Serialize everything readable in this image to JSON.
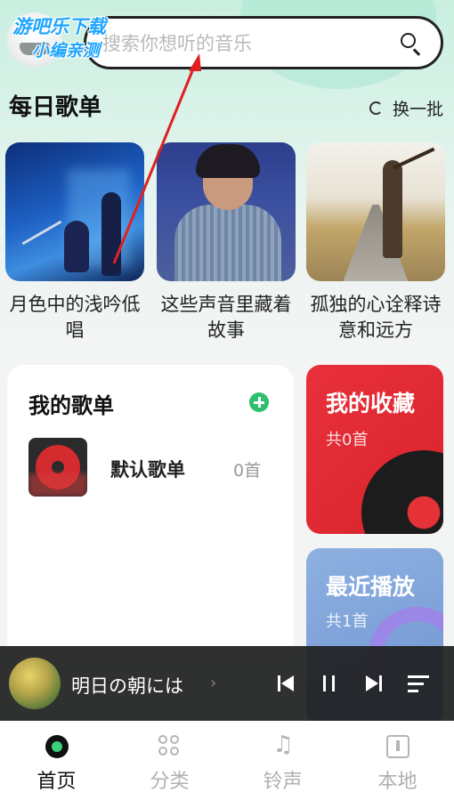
{
  "watermark": {
    "line1": "游吧乐下载",
    "line2": "小编亲测"
  },
  "search": {
    "placeholder": "搜索你想听的音乐"
  },
  "daily": {
    "title": "每日歌单",
    "refresh_label": "换一批",
    "playlists": [
      {
        "caption": "月色中的浅吟低唱"
      },
      {
        "caption": "这些声音里藏着故事"
      },
      {
        "caption": "孤独的心诠释诗意和远方"
      }
    ]
  },
  "my_playlists": {
    "title": "我的歌单",
    "items": [
      {
        "name": "默认歌单",
        "count": "0首"
      }
    ]
  },
  "favorites": {
    "title": "我的收藏",
    "count": "共0首",
    "color": "#e8303a"
  },
  "recent": {
    "title": "最近播放",
    "count": "共1首",
    "color": "#8eb1e2"
  },
  "player": {
    "song_title": "明日の朝には"
  },
  "tabs": [
    {
      "label": "首页",
      "icon": "home-icon",
      "active": true
    },
    {
      "label": "分类",
      "icon": "category-icon",
      "active": false
    },
    {
      "label": "铃声",
      "icon": "ringtone-icon",
      "active": false
    },
    {
      "label": "本地",
      "icon": "local-icon",
      "active": false
    }
  ],
  "colors": {
    "accent": "#2dbf6b",
    "annotation_arrow": "#e02020"
  }
}
